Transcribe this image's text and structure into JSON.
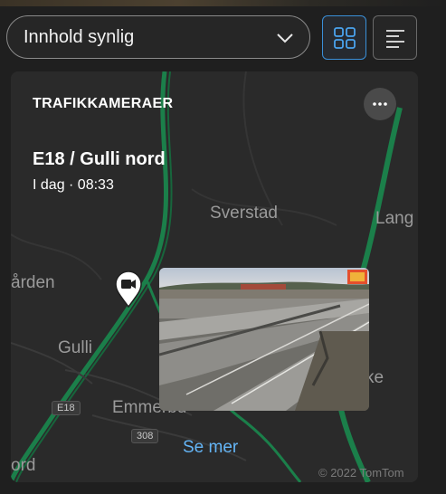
{
  "filter": {
    "label": "Innhold synlig"
  },
  "view_buttons": {
    "grid_icon": "grid-icon",
    "list_icon": "list-icon"
  },
  "card": {
    "title": "TRAFIKKAMERAER",
    "camera_name": "E18 / Gulli nord",
    "timestamp": "I dag · 08:33",
    "link_label": "Se mer",
    "copyright": "© 2022 TomTom"
  },
  "map": {
    "labels": {
      "sverstad": "Sverstad",
      "lang": "Lang",
      "arden": "ården",
      "gulli": "Gulli",
      "emmerbu": "Emmerbu",
      "ke": "ke",
      "ord": "ord"
    },
    "shields": {
      "e18": "E18",
      "r308": "308"
    },
    "colors": {
      "road": "#1b7f4a",
      "background": "#2a2a2a"
    }
  },
  "colors": {
    "accent": "#3a8fd8",
    "link": "#64b5f6"
  }
}
